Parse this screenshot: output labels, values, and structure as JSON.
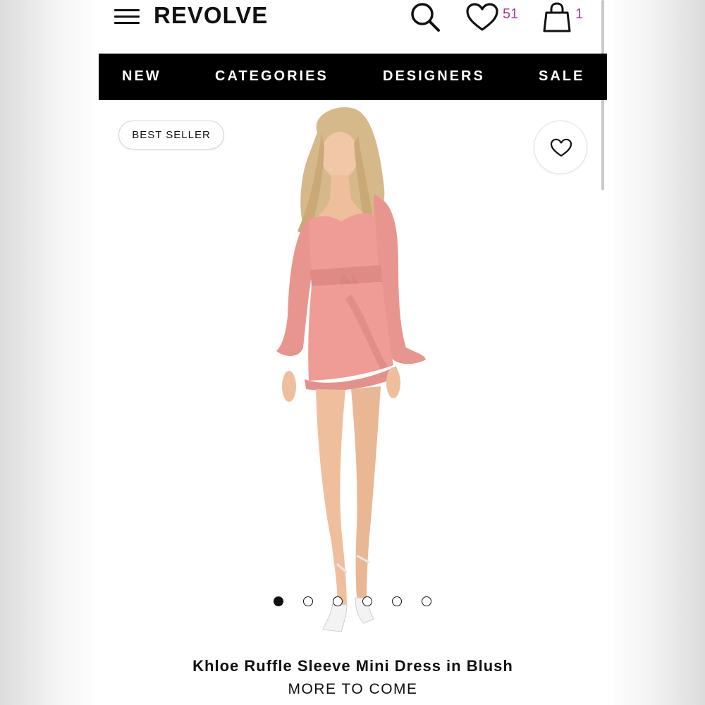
{
  "header": {
    "logo": "REVOLVE",
    "wishlist_count": "51",
    "bag_count": "1",
    "count_color": "#b03a93",
    "icons": [
      "menu-icon",
      "search-icon",
      "heart-icon",
      "shopping-bag-icon"
    ]
  },
  "nav": {
    "items": [
      {
        "label": "NEW"
      },
      {
        "label": "CATEGORIES"
      },
      {
        "label": "DESIGNERS"
      },
      {
        "label": "SALE"
      }
    ]
  },
  "product": {
    "badge": "BEST SELLER",
    "favorite_icon": "heart-outline-icon",
    "image": "model wearing blush pink long-sleeve ruffle mini dress with white strappy sandals",
    "dress_color": "#e8958f",
    "carousel": {
      "total": 6,
      "active": 1
    },
    "name": "Khloe Ruffle Sleeve Mini Dress in Blush",
    "brand": "MORE TO COME"
  }
}
